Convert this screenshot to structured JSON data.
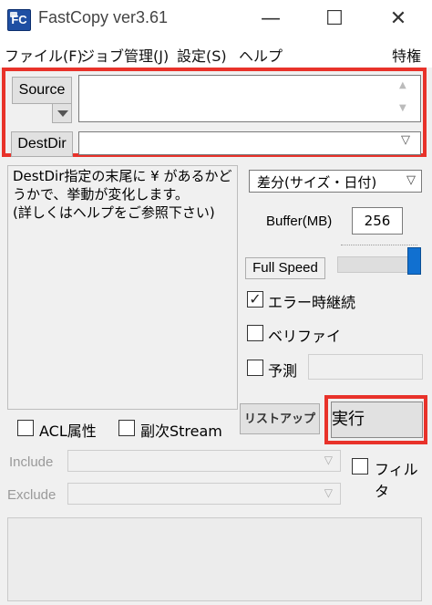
{
  "window": {
    "icon_text": "FC",
    "title": "FastCopy ver3.61",
    "minimize_glyph": "—",
    "maximize_glyph": "☐",
    "close_glyph": "✕"
  },
  "menu": {
    "file": "ファイル(F)",
    "job": "ジョブ管理(J)",
    "settings": "設定(S)",
    "help": "ヘルプ",
    "special": "特権"
  },
  "source": {
    "button_label": "Source",
    "value": ""
  },
  "destdir": {
    "button_label": "DestDir",
    "value": ""
  },
  "info": {
    "text": "DestDir指定の末尾に ¥ があるかどうかで、挙動が変化します。\n(詳しくはヘルプをご参照下さい)"
  },
  "options": {
    "mode_selected": "差分(サイズ・日付)",
    "buffer_label": "Buffer(MB)",
    "buffer_value": "256",
    "speed_label": "Full Speed",
    "speed_level": 1.0,
    "error_log_label": "エラー時継続",
    "error_log_checked": true,
    "verify_label": "ベリファイ",
    "verify_checked": false,
    "estimate_label": "予測",
    "estimate_checked": false
  },
  "attributes": {
    "acl_label": "ACL属性",
    "acl_checked": false,
    "stream_label": "副次Stream",
    "stream_checked": false
  },
  "actions": {
    "listup_label": "リストアップ",
    "run_label": "実行"
  },
  "filter": {
    "include_label": "Include",
    "exclude_label": "Exclude",
    "filter_label": "フィルタ",
    "filter_checked": false
  },
  "colors": {
    "highlight": "#e8322a",
    "slider_thumb": "#1170d0"
  },
  "icons": {
    "chevron": "chevron-down-icon",
    "check": "check-icon"
  }
}
